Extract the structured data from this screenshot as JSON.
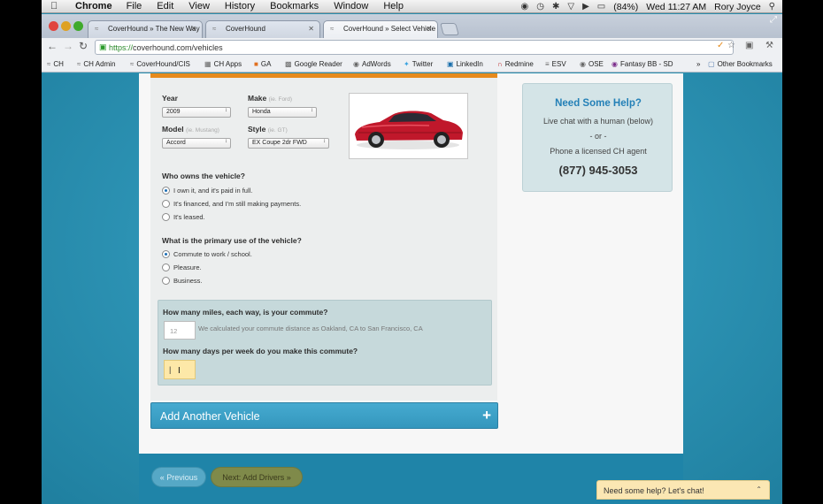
{
  "menubar": {
    "app": "Chrome",
    "items": [
      "File",
      "Edit",
      "View",
      "History",
      "Bookmarks",
      "Window",
      "Help"
    ],
    "battery": "(84%)",
    "clock": "Wed 11:27 AM",
    "user": "Rory Joyce"
  },
  "tabs": [
    {
      "label": "CoverHound » The New Way"
    },
    {
      "label": "CoverHound"
    },
    {
      "label": "CoverHound » Select Vehicle"
    }
  ],
  "toolbar": {
    "url_proto": "https://",
    "url_rest": "coverhound.com/vehicles"
  },
  "bookmarks": {
    "items": [
      "CH",
      "CH Admin",
      "CoverHound/CIS",
      "CH Apps",
      "GA",
      "Google Reader",
      "AdWords",
      "Twitter",
      "LinkedIn",
      "Redmine",
      "ESV",
      "OSE",
      "Fantasy BB - SD"
    ],
    "more": "»",
    "other": "Other Bookmarks"
  },
  "vehicle": {
    "year_label": "Year",
    "year_value": "2009",
    "make_label": "Make",
    "make_hint": "(ie. Ford)",
    "make_value": "Honda",
    "model_label": "Model",
    "model_hint": "(ie. Mustang)",
    "model_value": "Accord",
    "style_label": "Style",
    "style_hint": "(ie. GT)",
    "style_value": "EX Coupe 2dr FWD"
  },
  "ownership": {
    "question": "Who owns the vehicle?",
    "options": [
      "I own it, and it's paid in full.",
      "It's financed, and I'm still making payments.",
      "It's leased."
    ],
    "selected": 0
  },
  "usage": {
    "question": "What is the primary use of the vehicle?",
    "options": [
      "Commute to work / school.",
      "Pleasure.",
      "Business."
    ],
    "selected": 0
  },
  "commute": {
    "miles_question": "How many miles, each way, is your commute?",
    "miles_value": "12",
    "miles_note": "We calculated your commute distance as Oakland, CA to San Francisco, CA",
    "days_question": "How many days per week do you make this commute?",
    "days_value": "|"
  },
  "add_vehicle": {
    "label": "Add Another Vehicle",
    "icon": "+"
  },
  "help": {
    "title": "Need Some Help?",
    "line1": "Live chat with a human (below)",
    "or": "- or -",
    "line2": "Phone a licensed CH agent",
    "phone": "(877) 945-3053"
  },
  "nav": {
    "prev": "« Previous",
    "next": "Next: Add Drivers »"
  },
  "chat": {
    "label": "Need some help? Let's chat!"
  },
  "colors": {
    "accent_orange": "#e78a1c",
    "primary_blue": "#3497bd",
    "help_title": "#2480b7",
    "car_red": "#c0182b"
  }
}
